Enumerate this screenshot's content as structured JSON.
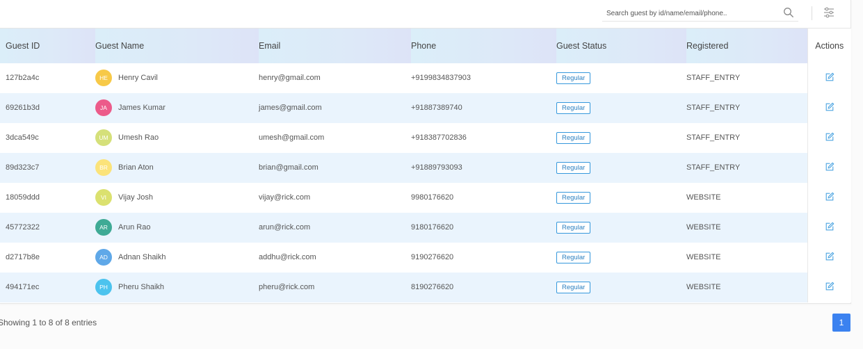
{
  "search": {
    "placeholder": "Search guest by id/name/email/phone.."
  },
  "table": {
    "headers": {
      "id": "Guest ID",
      "name": "Guest Name",
      "email": "Email",
      "phone": "Phone",
      "status": "Guest Status",
      "registered": "Registered",
      "actions": "Actions"
    },
    "rows": [
      {
        "id": "127b2a4c",
        "initials": "HE",
        "avatar_color": "#f7c948",
        "name": "Henry Cavil",
        "email": "henry@gmail.com",
        "phone": "+9199834837903",
        "status": "Regular",
        "registered": "STAFF_ENTRY"
      },
      {
        "id": "69261b3d",
        "initials": "JA",
        "avatar_color": "#ec5b8a",
        "name": "James Kumar",
        "email": "james@gmail.com",
        "phone": "+91887389740",
        "status": "Regular",
        "registered": "STAFF_ENTRY"
      },
      {
        "id": "3dca549c",
        "initials": "UM",
        "avatar_color": "#d5e07a",
        "name": "Umesh Rao",
        "email": "umesh@gmail.com",
        "phone": "+918387702836",
        "status": "Regular",
        "registered": "STAFF_ENTRY"
      },
      {
        "id": "89d323c7",
        "initials": "BR",
        "avatar_color": "#fbe37a",
        "name": "Brian Aton",
        "email": "brian@gmail.com",
        "phone": "+91889793093",
        "status": "Regular",
        "registered": "STAFF_ENTRY"
      },
      {
        "id": "18059ddd",
        "initials": "VI",
        "avatar_color": "#dbe16f",
        "name": "Vijay Josh",
        "email": "vijay@rick.com",
        "phone": "9980176620",
        "status": "Regular",
        "registered": "WEBSITE"
      },
      {
        "id": "45772322",
        "initials": "AR",
        "avatar_color": "#3faa95",
        "name": "Arun Rao",
        "email": "arun@rick.com",
        "phone": "9180176620",
        "status": "Regular",
        "registered": "WEBSITE"
      },
      {
        "id": "d2717b8e",
        "initials": "AD",
        "avatar_color": "#5fa8e8",
        "name": "Adnan Shaikh",
        "email": "addhu@rick.com",
        "phone": "9190276620",
        "status": "Regular",
        "registered": "WEBSITE"
      },
      {
        "id": "494171ec",
        "initials": "PH",
        "avatar_color": "#4cc3ee",
        "name": "Pheru Shaikh",
        "email": "pheru@rick.com",
        "phone": "8190276620",
        "status": "Regular",
        "registered": "WEBSITE"
      }
    ]
  },
  "footer": {
    "entries_text": "Showing 1 to 8 of 8 entries",
    "current_page": "1"
  },
  "colors": {
    "accent": "#3b82f0",
    "badge_border": "#3598dc",
    "row_alt": "#eaf4fd"
  },
  "icons": {
    "search": "search-icon",
    "filter": "filter-sliders-icon",
    "edit": "edit-icon"
  }
}
